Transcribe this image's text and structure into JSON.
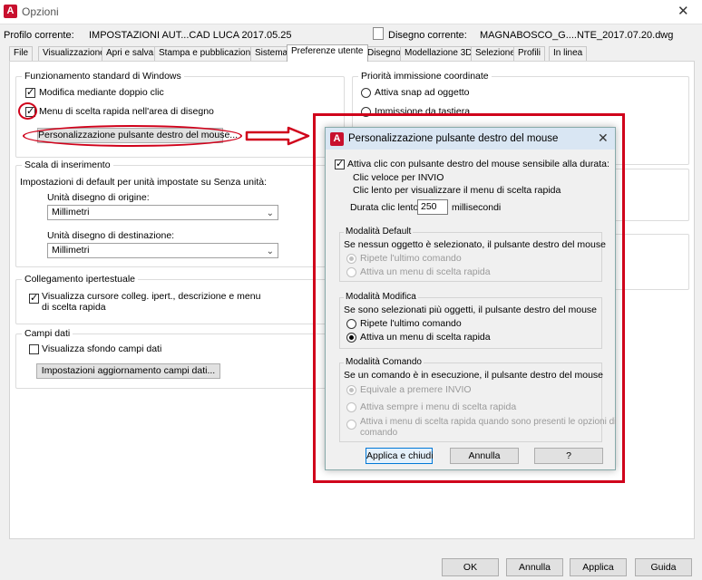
{
  "window": {
    "title": "Opzioni",
    "logo": "A",
    "close_glyph": "✕"
  },
  "header": {
    "profile_label": "Profilo corrente:",
    "profile_value": "IMPOSTAZIONI AUT...CAD LUCA 2017.05.25",
    "drawing_label": "Disegno corrente:",
    "drawing_value": "MAGNABOSCO_G....NTE_2017.07.20.dwg"
  },
  "tabs": [
    "File",
    "Visualizzazione",
    "Apri e salva",
    "Stampa e pubblicazione",
    "Sistema",
    "Preferenze utente",
    "Disegno",
    "Modellazione 3D",
    "Selezione",
    "Profili",
    "In linea"
  ],
  "active_tab": "Preferenze utente",
  "windows_standard": {
    "title": "Funzionamento standard di Windows",
    "double_click": "Modifica mediante doppio clic",
    "shortcut_menu": "Menu di scelta rapida nell'area di disegno",
    "customize_button": "Personalizzazione pulsante destro del mouse..."
  },
  "insert_scale": {
    "title": "Scala di inserimento",
    "description": "Impostazioni di default per unità impostate su Senza unità:",
    "source_label": "Unità disegno di origine:",
    "source_value": "Millimetri",
    "target_label": "Unità disegno di destinazione:",
    "target_value": "Millimetri"
  },
  "hyperlink": {
    "title": "Collegamento ipertestuale",
    "option_line1": "Visualizza cursore colleg. ipert., descrizione e menu",
    "option_line2": "di scelta rapida"
  },
  "fields": {
    "title": "Campi dati",
    "show_background": "Visualizza sfondo campi dati",
    "update_button": "Impostazioni aggiornamento campi dati..."
  },
  "coordinate_priority": {
    "title": "Priorità immissione coordinate",
    "option1": "Attiva snap ad oggetto",
    "option2": "Immissione da tastiera"
  },
  "subdialog": {
    "title": "Personalizzazione pulsante destro del mouse",
    "time_sensitive": "Attiva clic con pulsante destro del mouse sensibile alla durata:",
    "fast_click": "Clic veloce per INVIO",
    "slow_click": "Clic lento per visualizzare il menu di scelta rapida",
    "slow_duration_label": "Durata clic lento:",
    "slow_duration_value": "250",
    "slow_duration_unit": "millisecondi",
    "default_mode": {
      "title": "Modalità Default",
      "desc": "Se nessun oggetto è selezionato, il pulsante destro del mouse",
      "opt1": "Ripete l'ultimo comando",
      "opt2": "Attiva un menu di scelta rapida"
    },
    "edit_mode": {
      "title": "Modalità Modifica",
      "desc": "Se sono selezionati più oggetti, il pulsante destro del mouse",
      "opt1": "Ripete l'ultimo comando",
      "opt2": "Attiva un menu di scelta rapida"
    },
    "command_mode": {
      "title": "Modalità Comando",
      "desc": "Se un comando è in esecuzione, il pulsante destro del mouse",
      "opt1": "Equivale a premere INVIO",
      "opt2": "Attiva sempre i menu di scelta rapida",
      "opt3_line1": "Attiva i menu di scelta rapida quando sono presenti le opzioni di",
      "opt3_line2": "comando"
    },
    "apply_close": "Applica e chiudi",
    "cancel": "Annulla",
    "help": "?"
  },
  "footer": {
    "ok": "OK",
    "cancel": "Annulla",
    "apply": "Applica",
    "help": "Guida"
  },
  "colors": {
    "annotation_red": "#d0021b",
    "logo_red": "#c8102e"
  },
  "icons": [
    "autocad-logo-icon",
    "close-icon",
    "chevron-down-icon",
    "arrow-right-icon"
  ]
}
